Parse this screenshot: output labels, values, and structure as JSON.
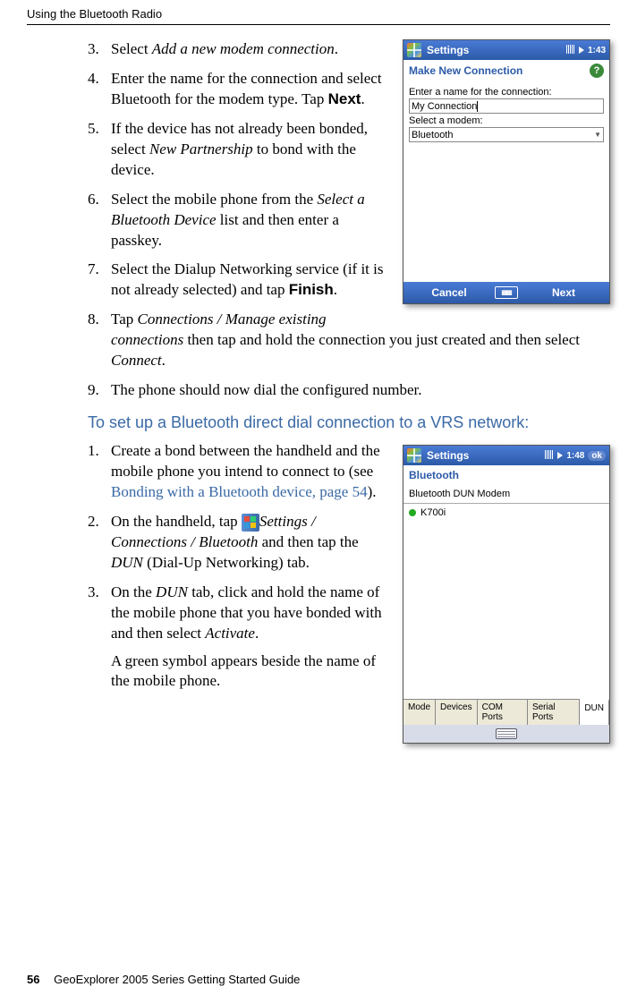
{
  "header": {
    "section_title": "Using the Bluetooth Radio"
  },
  "steps_a": [
    {
      "num": "3.",
      "text_pre": " Select ",
      "italic": "Add a new modem connection",
      "text_post": "."
    },
    {
      "num": "4.",
      "text": "Enter the name for the connection and select Bluetooth for the modem type. Tap ",
      "bold": "Next",
      "tail": "."
    },
    {
      "num": "5.",
      "text": "If the device has not already been bonded, select ",
      "italic": "New Partnership",
      "tail": " to bond with the device."
    },
    {
      "num": "6.",
      "text": "Select the mobile phone from the ",
      "italic": "Select a Bluetooth Device",
      "tail": " list and then enter a passkey."
    },
    {
      "num": "7.",
      "text": "Select the Dialup Networking service (if it is not already selected) and tap ",
      "bold": "Finish",
      "tail": "."
    },
    {
      "num": "8.",
      "text": "Tap ",
      "italic": "Connections / Manage existing connections",
      "tail": " then tap and hold the connection you just created and then select ",
      "italic2": "Connect",
      "tail2": "."
    },
    {
      "num": "9.",
      "text": "The phone should now dial the configured number."
    }
  ],
  "subheading": "To set up a Bluetooth direct dial connection to a VRS network:",
  "steps_b": [
    {
      "num": "1.",
      "text": "Create a bond between the handheld and the mobile phone you intend to connect to (see ",
      "link": "Bonding with a Bluetooth device, page 54",
      "tail": ")."
    },
    {
      "num": "2.",
      "text": "On the handheld, tap ",
      " mid": " / ",
      "italic": "Settings / Connections / Bluetooth",
      "tail": " and then tap the ",
      "italic2": "DUN",
      "tail2": " (Dial-Up Networking) tab."
    },
    {
      "num": "3.",
      "text": "On the ",
      "italic": "DUN",
      "tail": " tab, click and hold the name of the mobile phone that you have bonded with and then select ",
      "italic2": "Activate",
      "tail2": "."
    }
  ],
  "sub_para": "A green symbol appears beside the name of the mobile phone.",
  "shot1": {
    "tb_title": "Settings",
    "time": "1:43",
    "sub": "Make New Connection",
    "lbl1": "Enter a name for the connection:",
    "val1": "My Connection",
    "lbl2": "Select a modem:",
    "val2": "Bluetooth",
    "cancel": "Cancel",
    "next": "Next"
  },
  "shot2": {
    "tb_title": "Settings",
    "time": "1:48",
    "ok": "ok",
    "sub": "Bluetooth",
    "list_header": "Bluetooth DUN Modem",
    "item": "K700i",
    "tabs": [
      "Mode",
      "Devices",
      "COM Ports",
      "Serial Ports",
      "DUN"
    ]
  },
  "footer": {
    "page": "56",
    "title": "GeoExplorer 2005 Series Getting Started Guide"
  }
}
